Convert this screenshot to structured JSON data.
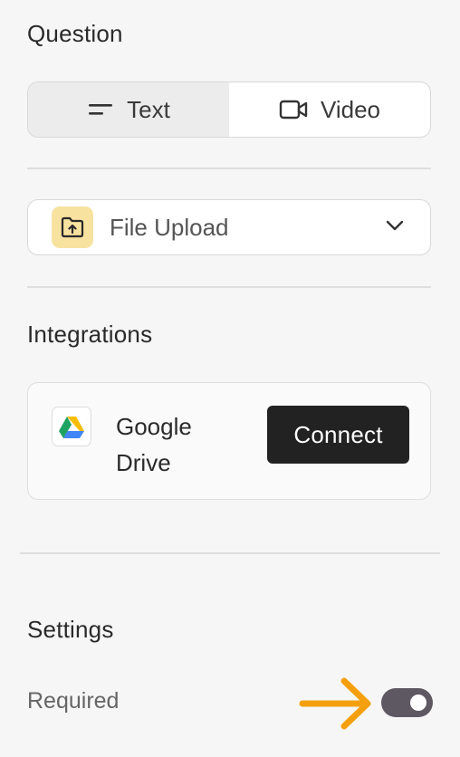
{
  "question": {
    "title": "Question",
    "tabs": [
      {
        "label": "Text",
        "icon": "text-lines-icon",
        "active": true
      },
      {
        "label": "Video",
        "icon": "video-camera-icon",
        "active": false
      }
    ]
  },
  "answer_type": {
    "selected": "File Upload",
    "icon": "folder-upload-icon",
    "icon_bg": "#f7e2a0"
  },
  "integrations": {
    "title": "Integrations",
    "items": [
      {
        "name": "Google Drive",
        "icon": "google-drive-icon",
        "action": "Connect"
      }
    ]
  },
  "settings": {
    "title": "Settings",
    "required": {
      "label": "Required",
      "enabled": true
    }
  },
  "colors": {
    "accent_arrow": "#f4a00d",
    "toggle_on": "#5d5862",
    "button_dark": "#222222"
  }
}
